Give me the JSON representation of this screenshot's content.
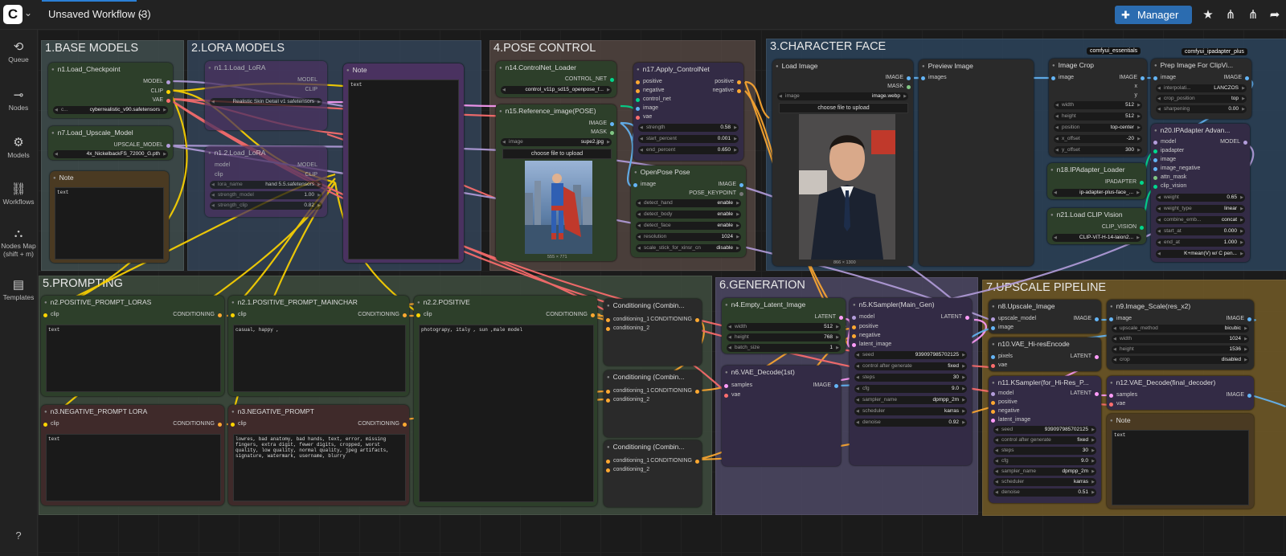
{
  "app": {
    "workflow_title": "Unsaved Workflow (3)",
    "manager_label": "Manager"
  },
  "sidebar": {
    "items": [
      {
        "label": "Queue",
        "icon": "history-icon"
      },
      {
        "label": "Nodes",
        "icon": "node-icon"
      },
      {
        "label": "Models",
        "icon": "models-icon"
      },
      {
        "label": "Workflows",
        "icon": "workflows-icon"
      },
      {
        "label": "Nodes Map\n(shift + m)",
        "icon": "map-icon"
      },
      {
        "label": "Templates",
        "icon": "templates-icon"
      }
    ],
    "help_label": "?"
  },
  "groups": {
    "g1": "1.BASE MODELS",
    "g2": "2.LORA MODELS",
    "g4": "4.POSE CONTROL",
    "g3": "3.CHARACTER FACE",
    "g5": "5.PROMPTING",
    "g6": "6.GENERATION",
    "g7": "7.UPSCALE PIPELINE"
  },
  "badges": {
    "b1": "comfyui_essentials",
    "b2": "comfyui_ipadapter_plus"
  },
  "nodes": {
    "ckpt": {
      "title": "n1.Load_Checkpoint",
      "out_model": "MODEL",
      "out_clip": "CLIP",
      "out_vae": "VAE",
      "widget": "cyberrealistic_v90.safetensors",
      "widget_prefix": "c..."
    },
    "upscale_model": {
      "title": "n7.Load_Upscale_Model",
      "out": "UPSCALE_MODEL",
      "widget": "4x_NickelbackFS_72000_G.pth"
    },
    "note1": {
      "title": "Note",
      "text": "text"
    },
    "lora1": {
      "title": "n1.1.Load_LoRA",
      "out_model": "MODEL",
      "out_clip": "CLIP",
      "widget": "Realistic Skin Detail v1 safetensors"
    },
    "lora2": {
      "title": "n1.2.Load_LoRA",
      "out_model": "MODEL",
      "out_clip": "CLIP",
      "in_model": "model",
      "in_clip": "clip",
      "w1_label": "lora_name",
      "w1_value": "hand 5.5.safetensors",
      "w2_label": "strength_model",
      "w2_value": "1.00",
      "w3_label": "strength_clip",
      "w3_value": "0.82"
    },
    "note2": {
      "title": "Note",
      "text": "text"
    },
    "controlnet_loader": {
      "title": "n14.ControlNet_Loader",
      "out": "CONTROL_NET",
      "widget": "control_v11p_sd15_openpose_f..."
    },
    "ref_image": {
      "title": "n15.Reference_image(POSE)",
      "out_image": "IMAGE",
      "out_mask": "MASK",
      "w_label": "image",
      "w_value": "supe2.jpg",
      "upload": "choose file to upload",
      "dims": "555 × 771"
    },
    "apply_cn": {
      "title": "n17.Apply_ControlNet",
      "in_pos": "positive",
      "in_neg": "negative",
      "in_cn": "control_net",
      "in_img": "image",
      "in_vae": "vae",
      "out_pos": "positive",
      "out_neg": "negative",
      "w1_label": "strength",
      "w1_value": "0.58",
      "w2_label": "start_percent",
      "w2_value": "0.001",
      "w3_label": "end_percent",
      "w3_value": "0.650"
    },
    "openpose": {
      "title": "OpenPose Pose",
      "in_img": "image",
      "out_img": "IMAGE",
      "out_kp": "POSE_KEYPOINT",
      "w1_label": "detect_hand",
      "w1_value": "enable",
      "w2_label": "detect_body",
      "w2_value": "enable",
      "w3_label": "detect_face",
      "w3_value": "enable",
      "w4_label": "resolution",
      "w4_value": "1024",
      "w5_label": "scale_stick_for_xinsr_cn",
      "w5_value": "disable"
    },
    "load_image": {
      "title": "Load Image",
      "out_image": "IMAGE",
      "out_mask": "MASK",
      "w_label": "image",
      "w_value": "image.webp",
      "upload": "choose file to upload",
      "dims": "866 × 1300"
    },
    "preview": {
      "title": "Preview Image",
      "in": "images"
    },
    "crop": {
      "title": "Image Crop",
      "in": "image",
      "out": "IMAGE",
      "out_x": "x",
      "out_y": "y",
      "w1_label": "width",
      "w1_value": "512",
      "w2_label": "height",
      "w2_value": "512",
      "w3_label": "position",
      "w3_value": "top-center",
      "w4_label": "x_offset",
      "w4_value": "-20",
      "w5_label": "y_offset",
      "w5_value": "300"
    },
    "prep": {
      "title": "Prep Image For ClipVi...",
      "in": "image",
      "out": "IMAGE",
      "w1_label": "interpolati...",
      "w1_value": "LANCZOS",
      "w2_label": "crop_position",
      "w2_value": "top",
      "w3_label": "sharpening",
      "w3_value": "0.00"
    },
    "ipadapter": {
      "title": "n20.IPAdapter Advan...",
      "in1": "model",
      "in2": "ipadapter",
      "in3": "image",
      "in4": "image_negative",
      "in5": "attn_mask",
      "in6": "clip_vision",
      "out": "MODEL",
      "w1_label": "weight",
      "w1_value": "0.65",
      "w2_label": "weight_type",
      "w2_value": "linear",
      "w3_label": "combine_emb...",
      "w3_value": "concat",
      "w4_label": "start_at",
      "w4_value": "0.000",
      "w5_label": "end_at",
      "w5_value": "1.000",
      "w6_value": "K+mean(V) w/ C pen..."
    },
    "ip_loader": {
      "title": "n18.IPAdapter_Loader",
      "out": "IPADAPTER",
      "widget": "ip-adapter-plus-face_..."
    },
    "clip_vision": {
      "title": "n21.Load CLIP Vision",
      "out": "CLIP_VISION",
      "widget": "CLIP-ViT-H-14-laion2..."
    },
    "pos_lora": {
      "title": "n2.POSITIVE_PROMPT_LORAS",
      "in": "clip",
      "out": "CONDITIONING",
      "text": "text"
    },
    "pos_main": {
      "title": "n2.1.POSITIVE_PROMPT_MAINCHAR",
      "in": "clip",
      "out": "CONDITIONING",
      "text": "casual, happy ,"
    },
    "pos2": {
      "title": "n2.2.POSITIVE",
      "in": "clip",
      "out": "CONDITIONING",
      "text": "photograpy, italy , sun ,male model"
    },
    "neg_lora": {
      "title": "n3.NEGATIVE_PROMPT LORA",
      "in": "clip",
      "out": "CONDITIONING",
      "text": "text"
    },
    "neg": {
      "title": "n3.NEGATIVE_PROMPT",
      "in": "clip",
      "out": "CONDITIONING",
      "text": "lowres, bad anatomy, bad hands, text, error, missing fingers, extra digit, fewer digits, cropped, worst quality, low quality, normal quality, jpeg artifacts, signature, watermark, username, blurry"
    },
    "comb1": {
      "title": "Conditioning (Combin...",
      "in1": "conditioning_1",
      "in2": "conditioning_2",
      "out": "CONDITIONING"
    },
    "comb2": {
      "title": "Conditioning (Combin...",
      "in1": "conditioning_1",
      "in2": "conditioning_2",
      "out": "CONDITIONING"
    },
    "comb3": {
      "title": "Conditioning (Combin...",
      "in1": "conditioning_1",
      "in2": "conditioning_2",
      "out": "CONDITIONING"
    },
    "latent": {
      "title": "n4.Empty_Latent_Image",
      "out": "LATENT",
      "w1_label": "width",
      "w1_value": "512",
      "w2_label": "height",
      "w2_value": "768",
      "w3_label": "batch_size",
      "w3_value": "1"
    },
    "vae_decode": {
      "title": "n6.VAE_Decode(1st)",
      "in1": "samples",
      "in2": "vae",
      "out": "IMAGE"
    },
    "ksampler": {
      "title": "n5.KSampler(Main_Gen)",
      "in1": "model",
      "in2": "positive",
      "in3": "negative",
      "in4": "latent_image",
      "out": "LATENT",
      "w1_label": "seed",
      "w1_value": "939097985702125",
      "w2_label": "control after generate",
      "w2_value": "fixed",
      "w3_label": "steps",
      "w3_value": "30",
      "w4_label": "cfg",
      "w4_value": "9.0",
      "w5_label": "sampler_name",
      "w5_value": "dpmpp_2m",
      "w6_label": "scheduler",
      "w6_value": "karras",
      "w7_label": "denoise",
      "w7_value": "0.92"
    },
    "upscale_img": {
      "title": "n8.Upscale_Image",
      "in1": "upscale_model",
      "in2": "image",
      "out": "IMAGE"
    },
    "img_scale": {
      "title": "n9.Image_Scale(res_x2)",
      "in": "image",
      "out": "IMAGE",
      "w1_label": "upscale_method",
      "w1_value": "bicubic",
      "w2_label": "width",
      "w2_value": "1024",
      "w3_label": "height",
      "w3_value": "1536",
      "w4_label": "crop",
      "w4_value": "disabled"
    },
    "vae_encode": {
      "title": "n10.VAE_Hi-resEncode",
      "in1": "pixels",
      "in2": "vae",
      "out": "LATENT"
    },
    "ksampler2": {
      "title": "n11.KSampler(for_Hi-Res_P...",
      "in1": "model",
      "in2": "positive",
      "in3": "negative",
      "in4": "latent_image",
      "out": "LATENT",
      "w1_label": "seed",
      "w1_value": "939097985702125",
      "w2_label": "control after generate",
      "w2_value": "fixed",
      "w3_label": "steps",
      "w3_value": "30",
      "w4_label": "cfg",
      "w4_value": "9.0",
      "w5_label": "sampler_name",
      "w5_value": "dpmpp_2m",
      "w6_label": "scheduler",
      "w6_value": "karras",
      "w7_label": "denoise",
      "w7_value": "0.51"
    },
    "vae_final": {
      "title": "n12.VAE_Decode(final_decoder)",
      "in1": "samples",
      "in2": "vae",
      "out": "IMAGE"
    },
    "note3": {
      "title": "Note",
      "text": "text"
    }
  },
  "colors": {
    "model": "#b39ddb",
    "clip": "#ffd500",
    "vae": "#ff6e6e",
    "conditioning": "#ffa931",
    "latent": "#ff9cf9",
    "image": "#64b5f6",
    "controlnet": "#00d78d",
    "green_node": "#2d3f2a",
    "purple_node": "#332b45",
    "red_node": "#3f2a2a",
    "brown_node": "#4a3a22",
    "accent": "#2b6cb0"
  }
}
